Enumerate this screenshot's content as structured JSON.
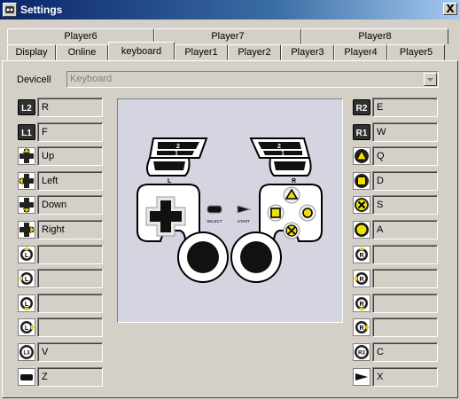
{
  "window": {
    "title": "Settings",
    "close_label": "X"
  },
  "tabs": {
    "top": [
      "Player6",
      "Player7",
      "Player8"
    ],
    "bottom": [
      "Display",
      "Online",
      "keyboard",
      "Player1",
      "Player2",
      "Player3",
      "Player4",
      "Player5"
    ],
    "active": "keyboard"
  },
  "device": {
    "label": "Devicell",
    "value": "Keyboard"
  },
  "left_bindings": [
    {
      "button": "L2",
      "key": "R"
    },
    {
      "button": "L1",
      "key": "F"
    },
    {
      "button": "dpad-up",
      "key": "Up"
    },
    {
      "button": "dpad-left",
      "key": "Left"
    },
    {
      "button": "dpad-down",
      "key": "Down"
    },
    {
      "button": "dpad-right",
      "key": "Right"
    },
    {
      "button": "left-stick-up",
      "key": ""
    },
    {
      "button": "left-stick-left",
      "key": ""
    },
    {
      "button": "left-stick-down",
      "key": ""
    },
    {
      "button": "left-stick-right",
      "key": ""
    },
    {
      "button": "L3",
      "key": "V"
    },
    {
      "button": "select",
      "key": "Z"
    }
  ],
  "right_bindings": [
    {
      "button": "R2",
      "key": "E"
    },
    {
      "button": "R1",
      "key": "W"
    },
    {
      "button": "triangle",
      "key": "Q"
    },
    {
      "button": "square",
      "key": "D"
    },
    {
      "button": "cross",
      "key": "S"
    },
    {
      "button": "circle",
      "key": "A"
    },
    {
      "button": "right-stick-up",
      "key": ""
    },
    {
      "button": "right-stick-left",
      "key": ""
    },
    {
      "button": "right-stick-down",
      "key": ""
    },
    {
      "button": "right-stick-right",
      "key": ""
    },
    {
      "button": "R3",
      "key": "C"
    },
    {
      "button": "start",
      "key": "X"
    }
  ],
  "icon_labels": {
    "L2": "L2",
    "L1": "L1",
    "R2": "R2",
    "R1": "R1",
    "L": "L",
    "R": "R",
    "L3": "L3",
    "R3": "R3",
    "trigger_2": "2",
    "trigger_1": "1"
  },
  "controller": {
    "select_label": "SELECT",
    "start_label": "START",
    "left_label": "L",
    "right_label": "R"
  }
}
